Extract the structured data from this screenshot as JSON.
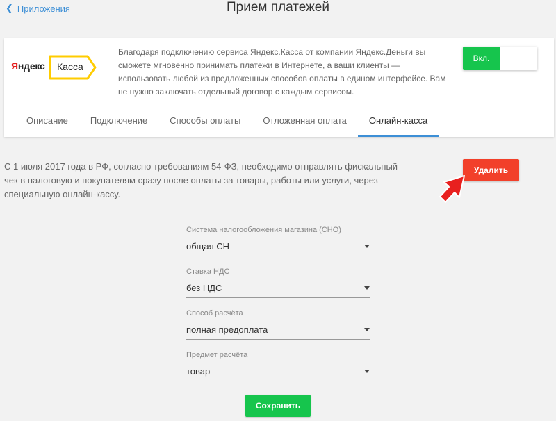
{
  "nav": {
    "back_label": "Приложения"
  },
  "page": {
    "title": "Прием платежей"
  },
  "card": {
    "logo": {
      "brand_left": "Я",
      "brand_rest": "ндекс",
      "product": "Касса"
    },
    "description": "Благодаря подключению сервиса Яндекс.Касса от компании Яндекс.Деньги вы сможете мгновенно принимать платежи в Интернете, а ваши клиенты — использовать любой из предложенных способов оплаты в едином интерфейсе. Вам не нужно заключать отдельный договор с каждым сервисом.",
    "toggle": {
      "on_label": "Вкл.",
      "state": "on"
    },
    "tabs": [
      {
        "label": "Описание",
        "active": false
      },
      {
        "label": "Подключение",
        "active": false
      },
      {
        "label": "Способы оплаты",
        "active": false
      },
      {
        "label": "Отложенная оплата",
        "active": false
      },
      {
        "label": "Онлайн-касса",
        "active": true
      }
    ]
  },
  "online_kassa": {
    "info": "С 1 июля 2017 года в РФ, согласно требованиям 54-ФЗ, необходимо отправлять фискальный чек в налоговую и покупателям сразу после оплаты за товары, работы или услуги, через специальную онлайн-кассу.",
    "delete_label": "Удалить",
    "fields": [
      {
        "label": "Система налогообложения магазина (СНО)",
        "value": "общая СН"
      },
      {
        "label": "Ставка НДС",
        "value": "без НДС"
      },
      {
        "label": "Способ расчёта",
        "value": "полная предоплата"
      },
      {
        "label": "Предмет расчёта",
        "value": "товар"
      }
    ],
    "save_label": "Сохранить"
  },
  "colors": {
    "accent_blue": "#3d8fd6",
    "toggle_green": "#16c54d",
    "delete_red": "#f2402a",
    "arrow_red": "#e8201f",
    "logo_yellow": "#ffcc00"
  },
  "icons": {
    "back": "chevron-left-icon",
    "arrow": "pointer-arrow-icon",
    "select": "caret-down-icon"
  }
}
